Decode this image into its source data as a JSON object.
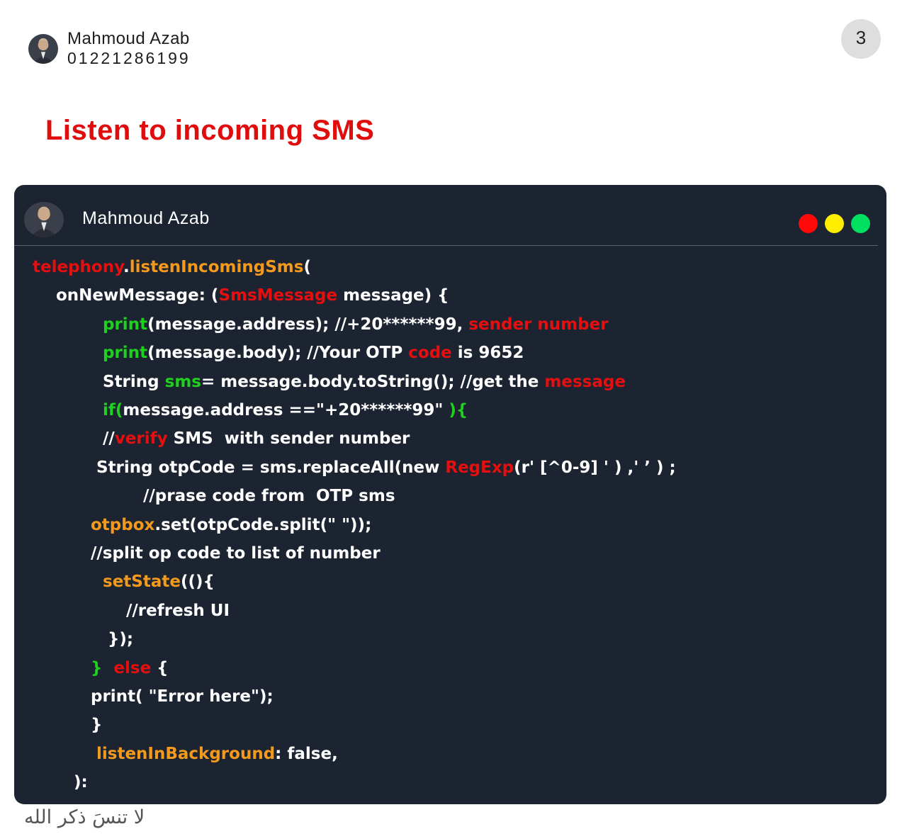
{
  "author": {
    "name": "Mahmoud Azab",
    "phone": "01221286199"
  },
  "page_number": "3",
  "title": "Listen to incoming SMS",
  "code_window": {
    "author_name": "Mahmoud Azab",
    "window_dots": [
      "#ff0a0a",
      "#ffee00",
      "#00e060"
    ],
    "code_lines": [
      [
        [
          "telephony",
          "r"
        ],
        [
          ".",
          ""
        ],
        [
          "listenIncomingSms",
          "o"
        ],
        [
          "(",
          ""
        ]
      ],
      [
        [
          "onNewMessage: (",
          ""
        ],
        [
          "SmsMessage",
          "r"
        ],
        [
          " message) {",
          ""
        ]
      ],
      [
        [
          "print",
          "g"
        ],
        [
          "(message.address); //+20******99, ",
          ""
        ],
        [
          "sender number",
          "r"
        ]
      ],
      [
        [
          "print",
          "g"
        ],
        [
          "(message.body); //Your OTP ",
          ""
        ],
        [
          "code",
          "r"
        ],
        [
          " is 9652",
          ""
        ]
      ],
      [
        [
          "String ",
          ""
        ],
        [
          "sms",
          "g"
        ],
        [
          "= message.body.toString(); //get the ",
          ""
        ],
        [
          "message",
          "r"
        ]
      ],
      [
        [
          "if(",
          "g"
        ],
        [
          "message.address ==\"+20******99\" ",
          ""
        ],
        [
          "){",
          "g"
        ]
      ],
      [
        [
          "//",
          ""
        ],
        [
          "verify",
          "r"
        ],
        [
          " SMS  with sender number",
          ""
        ]
      ],
      [
        [
          "String otpCode = sms.replaceAll(new ",
          ""
        ],
        [
          "RegExp",
          "r"
        ],
        [
          "(r' [^0-9] ' ) ,' ’ ) ;",
          ""
        ]
      ],
      [
        [
          "//prase code from  OTP sms",
          ""
        ]
      ],
      [
        [
          "otpbox",
          "o"
        ],
        [
          ".set(otpCode.split(\" \"));",
          ""
        ]
      ],
      [
        [
          "//split op code to list of number",
          ""
        ]
      ],
      [
        [
          "setState",
          "o"
        ],
        [
          "((){",
          ""
        ]
      ],
      [
        [
          "//refresh UI",
          ""
        ]
      ],
      [
        [
          "});",
          ""
        ]
      ],
      [
        [
          "}",
          "g"
        ],
        [
          "  ",
          ""
        ],
        [
          "else",
          "r"
        ],
        [
          " {",
          ""
        ]
      ],
      [
        [
          "print( \"Error here\");",
          ""
        ]
      ],
      [
        [
          "}",
          ""
        ]
      ],
      [
        [
          "listenInBackground",
          "o"
        ],
        [
          ": false,",
          ""
        ]
      ],
      [
        [
          "):",
          ""
        ]
      ]
    ]
  },
  "footer_text": "لا تنسَ ذكر الله"
}
